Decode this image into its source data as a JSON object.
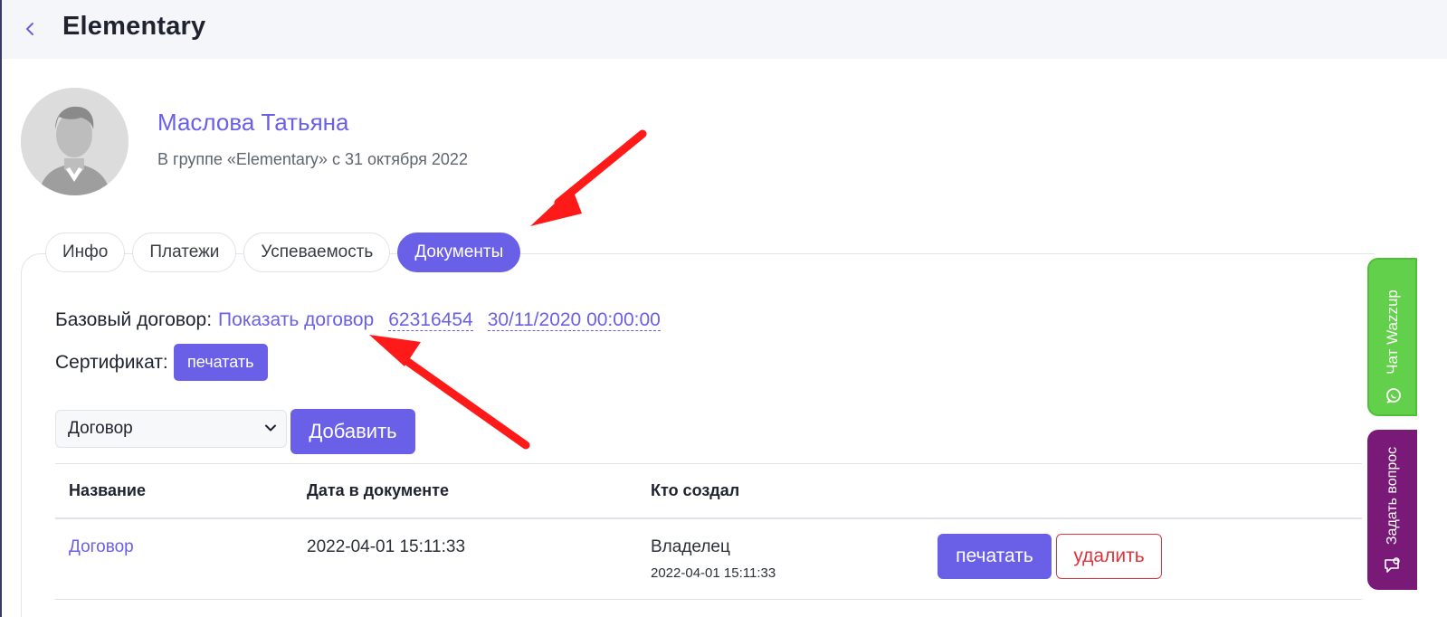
{
  "header": {
    "title": "Elementary"
  },
  "profile": {
    "name": "Маслова Татьяна",
    "subtitle": "В группе «Elementary» с 31 октября 2022"
  },
  "tabs": [
    {
      "label": "Инфо",
      "active": false
    },
    {
      "label": "Платежи",
      "active": false
    },
    {
      "label": "Успеваемость",
      "active": false
    },
    {
      "label": "Документы",
      "active": true
    }
  ],
  "documents": {
    "base_contract_label": "Базовый договор:",
    "show_contract_link": "Показать договор",
    "contract_number": "62316454",
    "contract_datetime": "30/11/2020 00:00:00",
    "certificate_label": "Сертификат:",
    "certificate_print": "печатать",
    "select_value": "Договор",
    "add_button": "Добавить"
  },
  "table": {
    "headers": [
      "Название",
      "Дата в документе",
      "Кто создал"
    ],
    "rows": [
      {
        "name": "Договор",
        "date": "2022-04-01 15:11:33",
        "creator": "Владелец",
        "created_at": "2022-04-01 15:11:33",
        "print": "печатать",
        "delete": "удалить"
      }
    ]
  },
  "side_widgets": {
    "chat": "Чат Wazzup",
    "ask": "Задать вопрос"
  },
  "colors": {
    "accent": "#6a60e8",
    "danger": "#d9363e",
    "chat_widget": "#62d04a",
    "ask_widget": "#7a1a78",
    "annotation_arrow": "#ff1a1a"
  }
}
